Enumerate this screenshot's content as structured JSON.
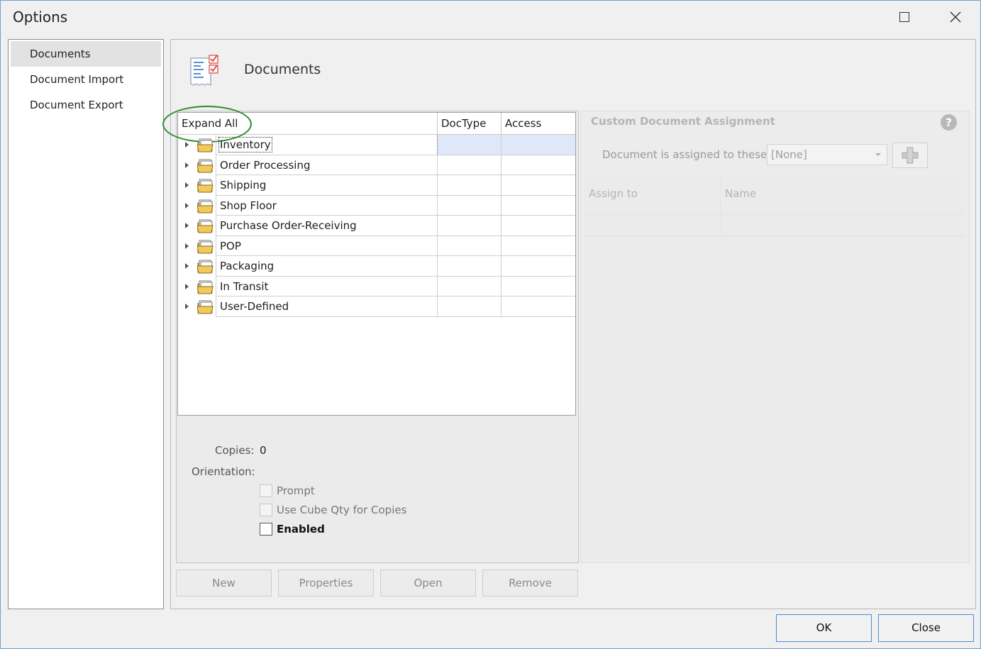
{
  "window": {
    "title": "Options"
  },
  "sidebar": {
    "items": [
      {
        "label": "Documents",
        "selected": true
      },
      {
        "label": "Document Import",
        "selected": false
      },
      {
        "label": "Document Export",
        "selected": false
      }
    ]
  },
  "header": {
    "title": "Documents",
    "icon": "document-checklist-icon"
  },
  "tree": {
    "columns": [
      "Expand All",
      "DocType",
      "Access"
    ],
    "rows": [
      {
        "label": "Inventory",
        "icon": "folder-icon"
      },
      {
        "label": "Order Processing",
        "icon": "folder-icon"
      },
      {
        "label": "Shipping",
        "icon": "folder-icon"
      },
      {
        "label": "Shop Floor",
        "icon": "folder-icon"
      },
      {
        "label": "Purchase Order-Receiving",
        "icon": "folder-icon"
      },
      {
        "label": "POP",
        "icon": "folder-icon"
      },
      {
        "label": "Packaging",
        "icon": "folder-icon"
      },
      {
        "label": "In Transit",
        "icon": "folder-icon"
      },
      {
        "label": "User-Defined",
        "icon": "folder-icon"
      }
    ]
  },
  "properties": {
    "copies_label": "Copies:",
    "copies_value": "0",
    "orientation_label": "Orientation:",
    "prompt_label": "Prompt",
    "cube_label": "Use Cube Qty  for Copies",
    "enabled_label": "Enabled"
  },
  "actions": {
    "new_label": "New",
    "properties_label": "Properties",
    "open_label": "Open",
    "remove_label": "Remove"
  },
  "custom_assignment": {
    "title": "Custom Document Assignment",
    "help_icon": "question-icon",
    "assigned_label": "Document is assigned to these:",
    "assigned_value": "[None]",
    "columns": [
      "Assign to",
      "Name"
    ]
  },
  "footer": {
    "ok_label": "OK",
    "close_label": "Close"
  },
  "colors": {
    "accent": "#4a8cd1",
    "annotation": "#2e8b2e",
    "focus_row": "#dfe8f8"
  }
}
